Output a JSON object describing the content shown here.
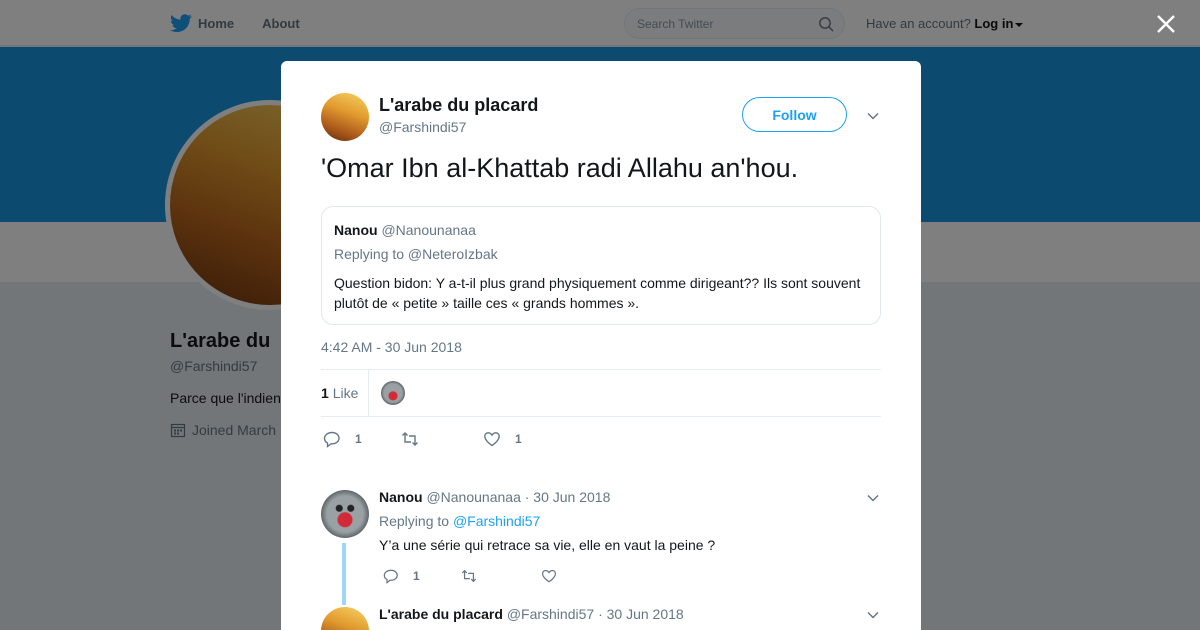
{
  "nav": {
    "home": "Home",
    "about": "About",
    "search_placeholder": "Search Twitter",
    "account_text": "Have an account?",
    "login": "Log in"
  },
  "profile": {
    "name": "L'arabe du",
    "handle": "@Farshindi57",
    "bio": "Parce que l'indien",
    "joined": "Joined March"
  },
  "tweet": {
    "author_name": "L'arabe du placard",
    "author_handle": "@Farshindi57",
    "follow_label": "Follow",
    "text": "'Omar Ibn al-Khattab radi Allahu an'hou.",
    "quote": {
      "name": "Nanou",
      "handle": "@Nanounanaa",
      "replying": "Replying to @NeteroIzbak",
      "text": "Question bidon: Y a-t-il plus grand physiquement comme dirigeant?? Ils sont souvent plutôt de « petite » taille ces « grands hommes »."
    },
    "timestamp": "4:42 AM - 30 Jun 2018",
    "likes_count": "1",
    "likes_label": "Like",
    "reply_count": "1",
    "like_count": "1"
  },
  "replies": [
    {
      "name": "Nanou",
      "handle": "@Nanounanaa",
      "date": "· 30 Jun 2018",
      "replying_prefix": "Replying to",
      "replying_handle": "@Farshindi57",
      "text": "Y’a une série qui retrace sa vie, elle en vaut la peine ?",
      "reply_count": "1"
    },
    {
      "name": "L'arabe du placard",
      "handle": "@Farshindi57",
      "date": "· 30 Jun 2018"
    }
  ],
  "colors": {
    "accent": "#1da1f2",
    "banner": "#1b95e0",
    "overlay": "rgba(0,0,0,0.5)"
  }
}
